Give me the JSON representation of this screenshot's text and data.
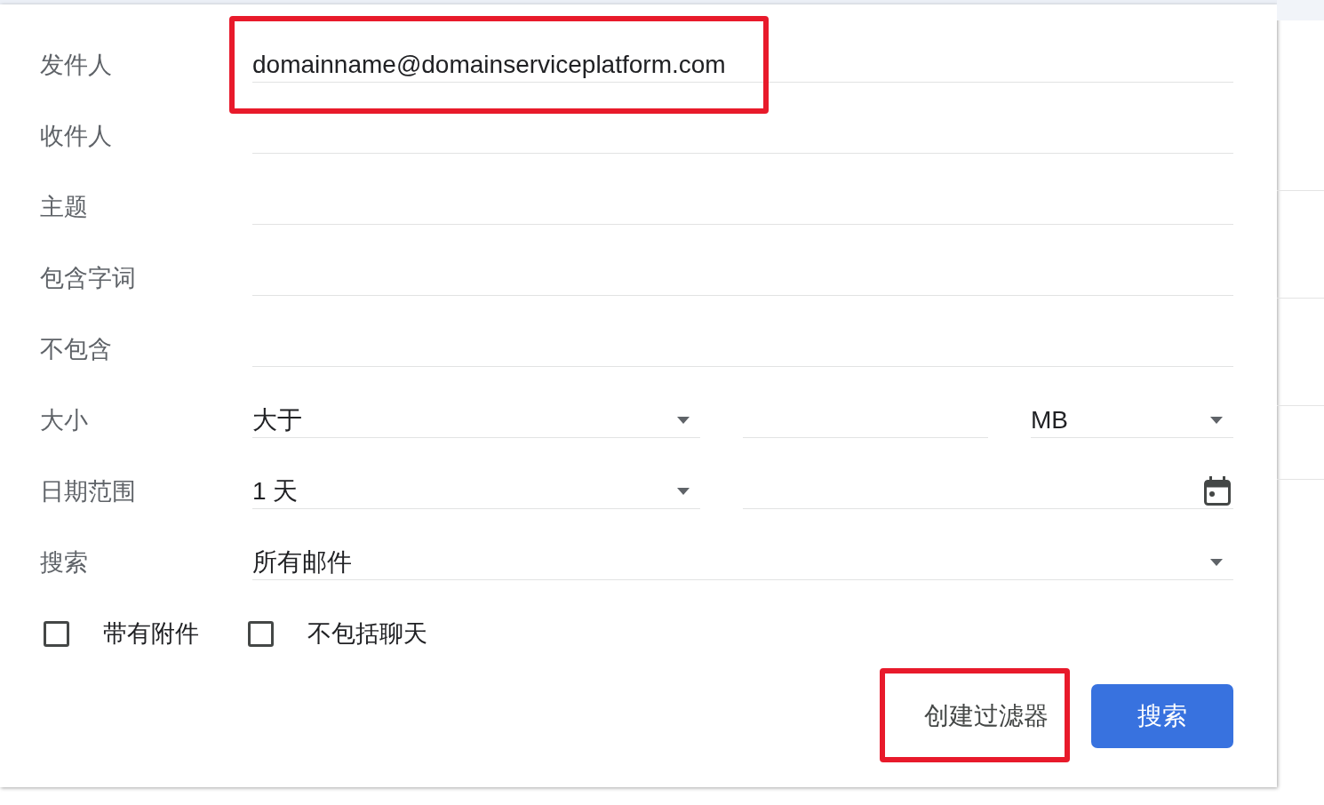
{
  "fields": [
    {
      "kind": "text",
      "label": "发件人",
      "value": "domainname@domainserviceplatform.com",
      "highlighted": true
    },
    {
      "kind": "text",
      "label": "收件人",
      "highlighted": false
    },
    {
      "kind": "text",
      "label": "主题",
      "highlighted": false
    },
    {
      "kind": "text",
      "label": "包含字词",
      "highlighted": false
    },
    {
      "kind": "text",
      "label": "不包含",
      "highlighted": false
    },
    {
      "kind": "size",
      "label": "大小",
      "comparator": "大于",
      "unit": "MB"
    },
    {
      "kind": "date",
      "label": "日期范围",
      "range": "1 天"
    },
    {
      "kind": "select",
      "label": "搜索",
      "value": "所有邮件"
    }
  ],
  "checkboxes": [
    {
      "label": "带有附件",
      "checked": false
    },
    {
      "label": "不包括聊天",
      "checked": false
    }
  ],
  "buttons": [
    {
      "kind": "text",
      "label": "创建过滤器",
      "highlighted": true
    },
    {
      "kind": "primary",
      "label": "搜索",
      "highlighted": false
    }
  ]
}
